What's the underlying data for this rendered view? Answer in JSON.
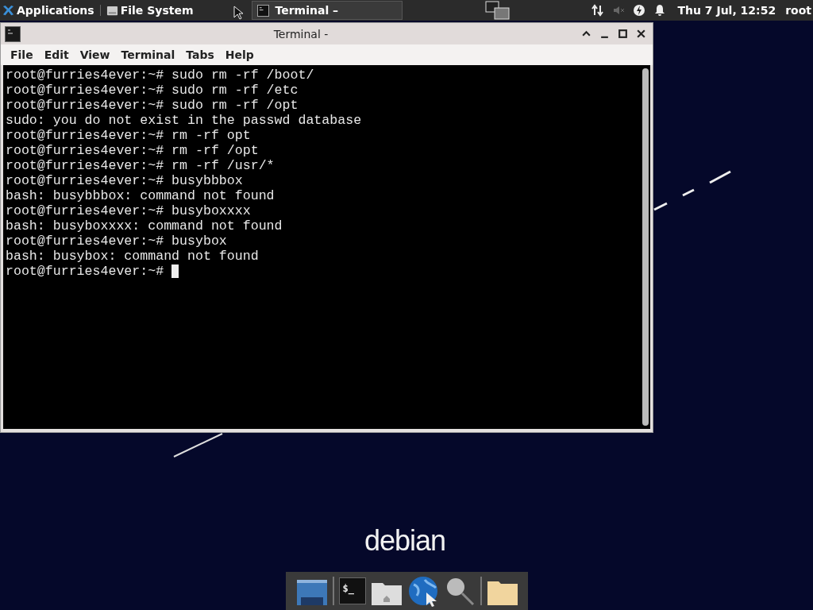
{
  "top_panel": {
    "applications": "Applications",
    "places": "File System",
    "tasks": [
      {
        "label": "Terminal –",
        "selected": true
      }
    ],
    "clock": "Thu  7 Jul, 12:52",
    "user": "root"
  },
  "window": {
    "title": "Terminal -",
    "menu": [
      "File",
      "Edit",
      "View",
      "Terminal",
      "Tabs",
      "Help"
    ],
    "terminal": {
      "cursor_visible": true,
      "lines": [
        "root@furries4ever:~# sudo rm -rf /boot/",
        "root@furries4ever:~# sudo rm -rf /etc",
        "root@furries4ever:~# sudo rm -rf /opt",
        "sudo: you do not exist in the passwd database",
        "root@furries4ever:~# rm -rf opt",
        "root@furries4ever:~# rm -rf /opt",
        "root@furries4ever:~# rm -rf /usr/*",
        "root@furries4ever:~# busybbbox",
        "bash: busybbbox: command not found",
        "root@furries4ever:~# busyboxxxx",
        "bash: busyboxxxx: command not found",
        "root@furries4ever:~# busybox",
        "bash: busybox: command not found",
        "root@furries4ever:~# "
      ]
    }
  },
  "desktop": {
    "logo": "debian"
  },
  "dock": {
    "items": [
      {
        "kind": "desktop"
      },
      {
        "kind": "terminal",
        "glyph": "$_"
      },
      {
        "kind": "home"
      },
      {
        "kind": "web"
      },
      {
        "kind": "search"
      },
      {
        "kind": "separator"
      },
      {
        "kind": "folder"
      }
    ]
  }
}
